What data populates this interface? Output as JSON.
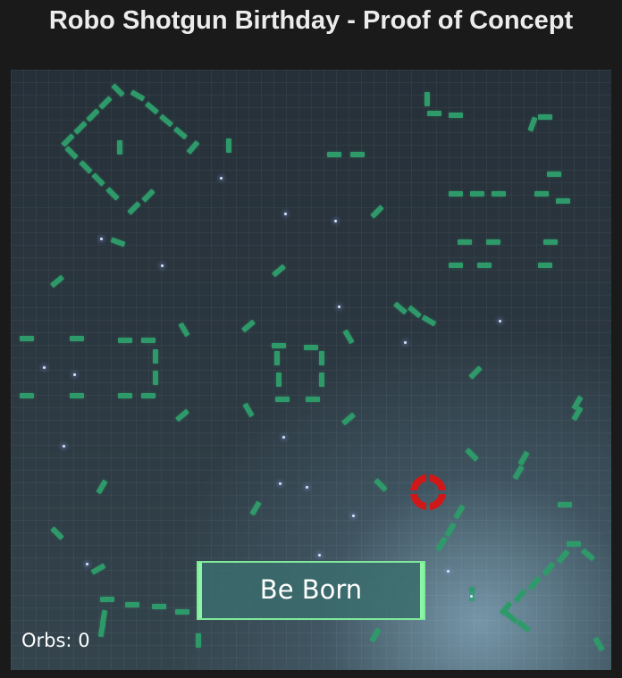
{
  "title": "Robo Shotgun Birthday - Proof of Concept",
  "game": {
    "start_button_label": "Be Born",
    "orbs_label": "Orbs:",
    "orbs_count": "0",
    "colors": {
      "segment": "#2e9a6a",
      "button_border": "#8af5a5",
      "crosshair": "#d01818",
      "background": "#2b3740"
    },
    "icons": [
      "crosshair-icon"
    ]
  }
}
